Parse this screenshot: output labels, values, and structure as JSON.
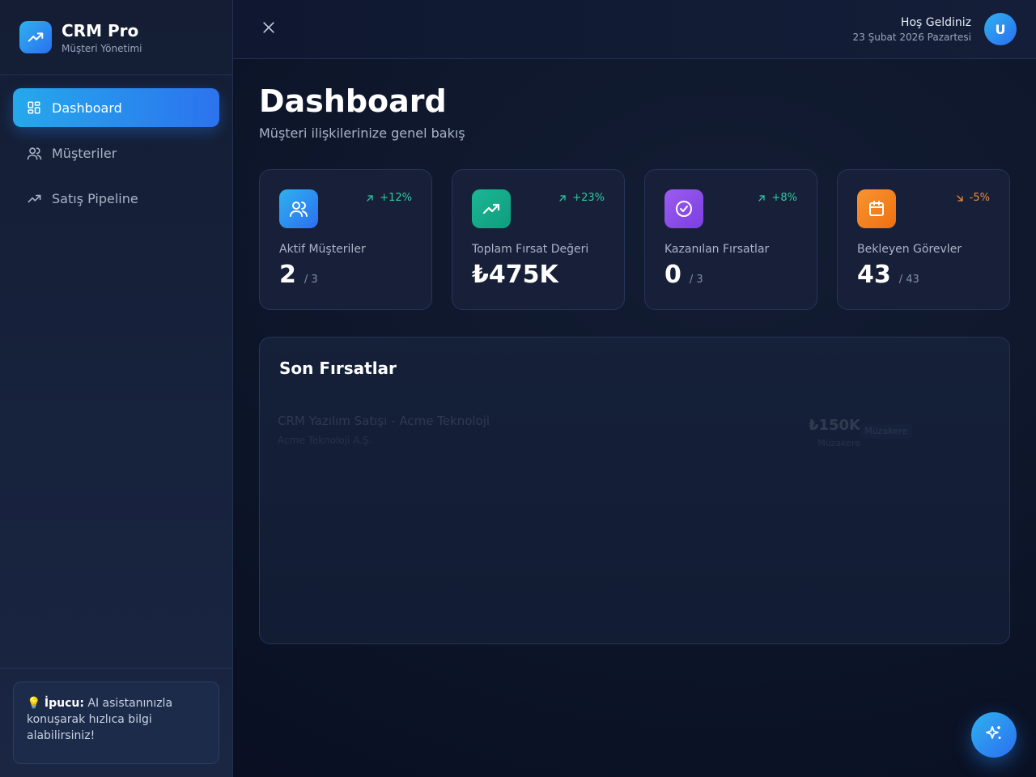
{
  "brand": {
    "title": "CRM Pro",
    "subtitle": "Müşteri Yönetimi",
    "logo_icon": "trending-up-icon"
  },
  "sidebar": {
    "items": [
      {
        "label": "Dashboard",
        "icon": "dashboard-icon",
        "active": true
      },
      {
        "label": "Müşteriler",
        "icon": "users-icon",
        "active": false
      },
      {
        "label": "Satış Pipeline",
        "icon": "trending-up-icon",
        "active": false
      }
    ],
    "tip": {
      "emoji": "💡",
      "title": "İpucu:",
      "text": " AI asistanınızla konuşarak hızlıca bilgi alabilirsiniz!"
    }
  },
  "header": {
    "welcome": "Hoş Geldiniz",
    "date": "23 Şubat 2026 Pazartesi",
    "avatar_initial": "U"
  },
  "main": {
    "title": "Dashboard",
    "subtitle": "Müşteri ilişkilerinize genel bakış",
    "cards": [
      {
        "label": "Aktif Müşteriler",
        "value": "2",
        "sub": "/ 3",
        "trend": "+12%",
        "trend_dir": "up",
        "icon": "users-icon",
        "color": "#2b8ff0"
      },
      {
        "label": "Toplam Fırsat Değeri",
        "value": "₺475K",
        "sub": "",
        "trend": "+23%",
        "trend_dir": "up",
        "icon": "trending-up-icon",
        "color": "#14a889"
      },
      {
        "label": "Kazanılan Fırsatlar",
        "value": "0",
        "sub": "/ 3",
        "trend": "+8%",
        "trend_dir": "up",
        "icon": "check-circle-icon",
        "color": "#8b4ee8"
      },
      {
        "label": "Bekleyen Görevler",
        "value": "43",
        "sub": "/ 43",
        "trend": "-5%",
        "trend_dir": "down",
        "icon": "calendar-icon",
        "color": "#f07b1a"
      }
    ],
    "recent": {
      "title": "Son Fırsatlar",
      "items": [
        {
          "title": "CRM Yazılım Satışı - Acme Teknoloji",
          "company": "Acme Teknoloji A.Ş.",
          "amount": "₺150K",
          "stage": "Müzakere",
          "badge": "Müzakere"
        }
      ]
    }
  },
  "colors": {
    "accent": "#2b8ff0",
    "up": "#2fc9a0",
    "down": "#f08a3a"
  },
  "fab": {
    "icon": "sparkles-icon"
  }
}
